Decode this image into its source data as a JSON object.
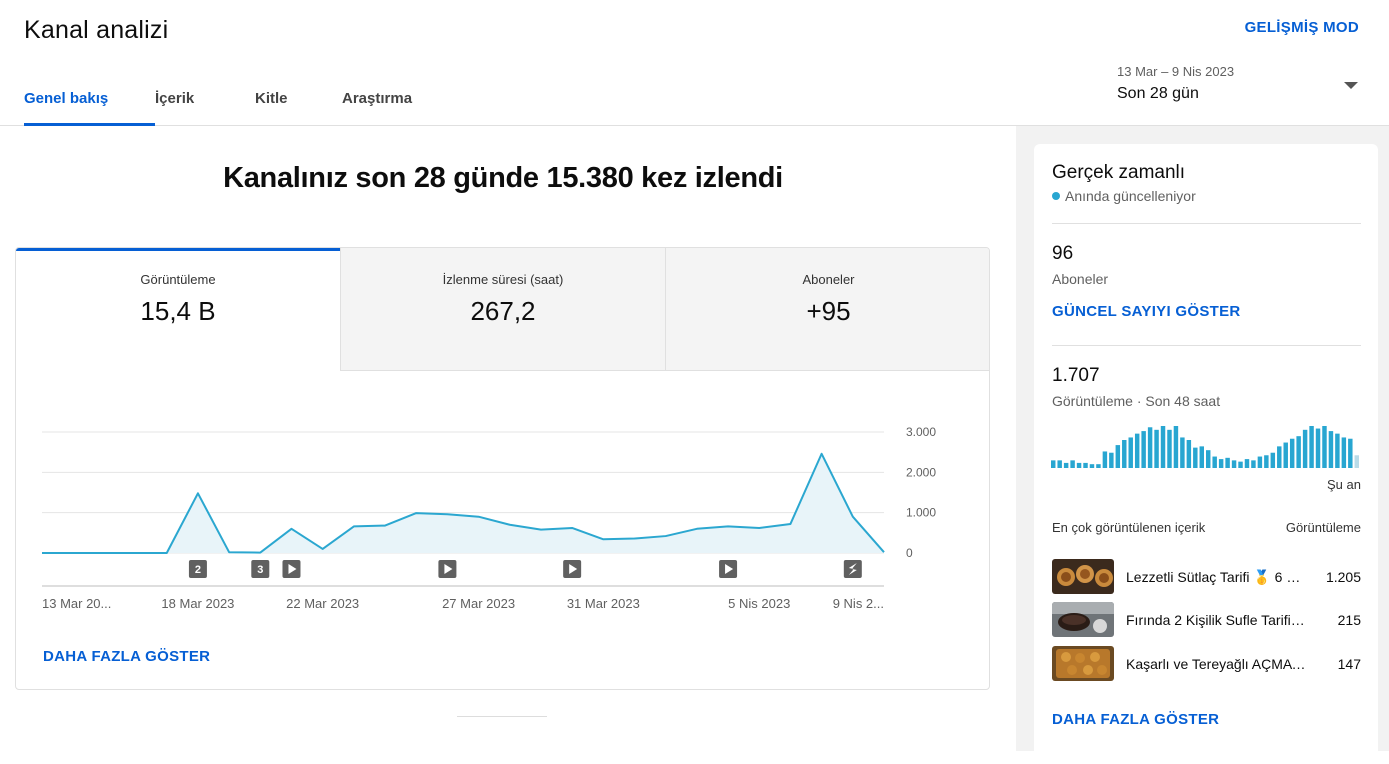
{
  "header": {
    "title": "Kanal analizi",
    "advanced_mode": "GELİŞMİŞ MOD",
    "tabs": [
      {
        "label": "Genel bakış",
        "active": true
      },
      {
        "label": "İçerik",
        "active": false
      },
      {
        "label": "Kitle",
        "active": false
      },
      {
        "label": "Araştırma",
        "active": false
      }
    ],
    "date_range": "13 Mar – 9 Nis 2023",
    "date_label": "Son 28 gün"
  },
  "main": {
    "headline": "Kanalınız son 28 günde 15.380 kez izlendi",
    "metrics": [
      {
        "label": "Görüntüleme",
        "value": "15,4 B",
        "active": true
      },
      {
        "label": "İzlenme süresi (saat)",
        "value": "267,2",
        "active": false
      },
      {
        "label": "Aboneler",
        "value": "+95",
        "active": false
      }
    ],
    "more_label": "DAHA FAZLA GÖSTER"
  },
  "chart_data": {
    "type": "area",
    "metric": "Görüntüleme",
    "x": [
      "13 Mar",
      "14 Mar",
      "15 Mar",
      "16 Mar",
      "17 Mar",
      "18 Mar",
      "19 Mar",
      "20 Mar",
      "21 Mar",
      "22 Mar",
      "23 Mar",
      "24 Mar",
      "25 Mar",
      "26 Mar",
      "27 Mar",
      "28 Mar",
      "29 Mar",
      "30 Mar",
      "31 Mar",
      "1 Nis",
      "2 Nis",
      "3 Nis",
      "4 Nis",
      "5 Nis",
      "6 Nis",
      "7 Nis",
      "8 Nis",
      "9 Nis"
    ],
    "values": [
      0,
      0,
      0,
      0,
      0,
      1480,
      20,
      10,
      600,
      100,
      660,
      680,
      990,
      960,
      900,
      700,
      580,
      620,
      340,
      360,
      420,
      600,
      660,
      620,
      720,
      2460,
      900,
      20
    ],
    "yticks": [
      "3.000",
      "2.000",
      "1.000",
      "0"
    ],
    "ylim": [
      0,
      3000
    ],
    "xtick_labels": [
      {
        "index": 0,
        "label": "13 Mar 20..."
      },
      {
        "index": 5,
        "label": "18 Mar 2023"
      },
      {
        "index": 9,
        "label": "22 Mar 2023"
      },
      {
        "index": 14,
        "label": "27 Mar 2023"
      },
      {
        "index": 18,
        "label": "31 Mar 2023"
      },
      {
        "index": 23,
        "label": "5 Nis 2023"
      },
      {
        "index": 27,
        "label": "9 Nis 2..."
      }
    ],
    "markers": [
      {
        "index": 5,
        "kind": "count",
        "text": "2"
      },
      {
        "index": 7,
        "kind": "count",
        "text": "3"
      },
      {
        "index": 8,
        "kind": "video"
      },
      {
        "index": 13,
        "kind": "video"
      },
      {
        "index": 17,
        "kind": "video"
      },
      {
        "index": 22,
        "kind": "video"
      },
      {
        "index": 26,
        "kind": "shorts"
      }
    ],
    "grid": true,
    "line_color": "#2ba7d0",
    "fill_color": "#e8f4f9"
  },
  "realtime": {
    "title": "Gerçek zamanlı",
    "subtitle": "Anında güncelleniyor",
    "subscribers_value": "96",
    "subscribers_label": "Aboneler",
    "show_count_label": "GÜNCEL SAYIYI GÖSTER",
    "views_value": "1.707",
    "views_label": "Görüntüleme · Son 48 saat",
    "now_label": "Şu an",
    "bars": [
      6,
      6,
      4,
      6,
      4,
      4,
      3,
      3,
      13,
      12,
      18,
      22,
      24,
      27,
      29,
      32,
      30,
      33,
      30,
      33,
      24,
      22,
      16,
      17,
      14,
      9,
      7,
      8,
      6,
      5,
      7,
      6,
      9,
      10,
      12,
      17,
      20,
      23,
      25,
      30,
      33,
      31,
      33,
      29,
      27,
      24,
      23,
      10
    ],
    "top_header_left": "En çok görüntülenen içerik",
    "top_header_right": "Görüntüleme",
    "top_content": [
      {
        "title": "Lezzetli Sütlaç Tarifi 🥇 6 …",
        "views": "1.205"
      },
      {
        "title": "Fırında 2 Kişilik Sufle Tarifi …",
        "views": "215"
      },
      {
        "title": "Kaşarlı ve Tereyağlı AÇMA …",
        "views": "147"
      }
    ],
    "more_label": "DAHA FAZLA GÖSTER"
  },
  "colors": {
    "accent": "#065fd4",
    "chart_line": "#2ba7d0",
    "bar": "#28a6d1"
  }
}
